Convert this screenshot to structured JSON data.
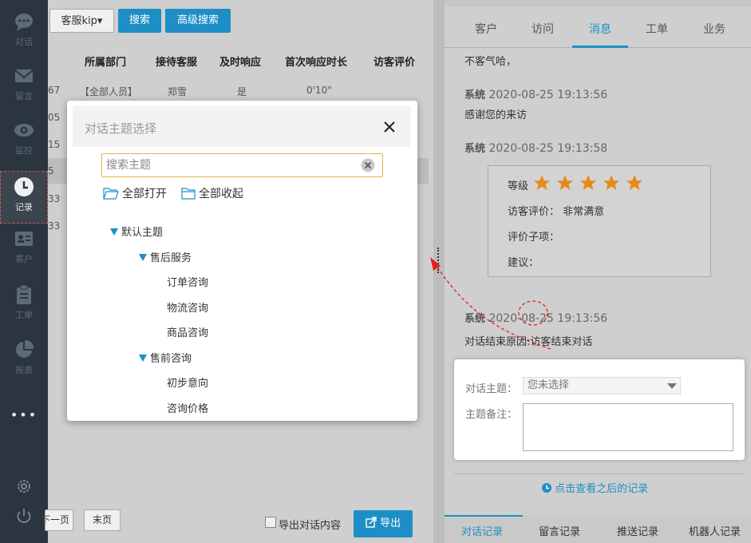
{
  "sidebar": {
    "items": [
      {
        "label": "对话",
        "icon": "chat-bubble-icon"
      },
      {
        "label": "留言",
        "icon": "mail-icon"
      },
      {
        "label": "监控",
        "icon": "eye-icon"
      },
      {
        "label": "记录",
        "icon": "clock-icon"
      },
      {
        "label": "客户",
        "icon": "id-card-icon"
      },
      {
        "label": "工单",
        "icon": "clipboard-icon"
      },
      {
        "label": "报表",
        "icon": "pie-chart-icon"
      }
    ],
    "more": "•••"
  },
  "leftpanel": {
    "filter_value": "客服kip▾",
    "search_label": "搜索",
    "advanced_search_label": "高级搜索",
    "columns": [
      "所属部门",
      "接待客服",
      "及时响应",
      "首次响应时长",
      "访客评价"
    ],
    "row": {
      "prefix": "67",
      "dept": "【全部人员】",
      "agent": "郑雪",
      "timely": "是",
      "first_resp": "0'10\""
    },
    "row_prefixes": [
      "05",
      "15",
      "5",
      "33",
      "33"
    ],
    "prev_page": "下一页",
    "last_page": "末页",
    "export_checkbox_label": "导出对话内容",
    "export_label": "导出"
  },
  "rightpanel": {
    "tabs": [
      "客户",
      "访问",
      "消息",
      "工单",
      "业务"
    ],
    "messages": {
      "m0": "不客气哈，",
      "sys": "系统",
      "t1": "2020-08-25 19:13:56",
      "m1": "感谢您的来访",
      "t2": "2020-08-25 19:13:58",
      "t3": "2020-08-25 19:13:56",
      "m3": "对话结束原因:访客结束对话"
    },
    "rating": {
      "level_label": "等级",
      "stars": 5,
      "eval_label": "访客评价：",
      "eval_value": "非常满意",
      "subitem_label": "评价子项：",
      "suggest_label": "建议："
    },
    "topic": {
      "topic_label": "对话主题：",
      "topic_placeholder": "您未选择",
      "note_label": "主题备注："
    },
    "view_later": "点击查看之后的记录",
    "bottom_tabs": [
      "对话记录",
      "留言记录",
      "推送记录",
      "机器人记录"
    ]
  },
  "modal": {
    "title": "对话主题选择",
    "search_placeholder": "搜索主题",
    "expand_all": "全部打开",
    "collapse_all": "全部收起",
    "tree": {
      "root": "默认主题",
      "after_sales": "售后服务",
      "after_sales_items": [
        "订单咨询",
        "物流咨询",
        "商品咨询"
      ],
      "pre_sales": "售前咨询",
      "pre_sales_items": [
        "初步意向",
        "咨询价格"
      ]
    }
  },
  "colors": {
    "accent": "#1e8fc6",
    "star": "#e88a1a",
    "annotation": "#e02020"
  }
}
